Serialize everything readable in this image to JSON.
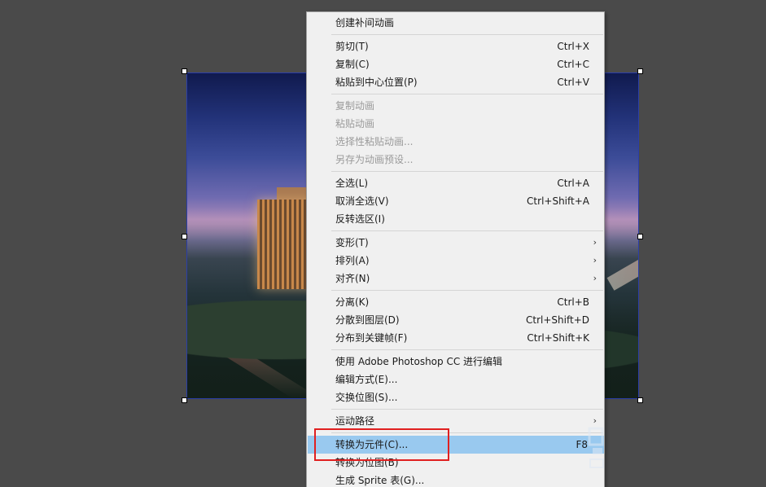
{
  "context_menu": {
    "items": [
      {
        "label": "创建补间动画",
        "shortcut": "",
        "disabled": false
      },
      {
        "label": "剪切(T)",
        "shortcut": "Ctrl+X",
        "disabled": false
      },
      {
        "label": "复制(C)",
        "shortcut": "Ctrl+C",
        "disabled": false
      },
      {
        "label": "粘贴到中心位置(P)",
        "shortcut": "Ctrl+V",
        "disabled": false
      },
      {
        "label": "复制动画",
        "shortcut": "",
        "disabled": true
      },
      {
        "label": "粘贴动画",
        "shortcut": "",
        "disabled": true
      },
      {
        "label": "选择性粘贴动画...",
        "shortcut": "",
        "disabled": true
      },
      {
        "label": "另存为动画预设...",
        "shortcut": "",
        "disabled": true
      },
      {
        "label": "全选(L)",
        "shortcut": "Ctrl+A",
        "disabled": false
      },
      {
        "label": "取消全选(V)",
        "shortcut": "Ctrl+Shift+A",
        "disabled": false
      },
      {
        "label": "反转选区(I)",
        "shortcut": "",
        "disabled": false
      },
      {
        "label": "变形(T)",
        "shortcut": "",
        "submenu": true
      },
      {
        "label": "排列(A)",
        "shortcut": "",
        "submenu": true
      },
      {
        "label": "对齐(N)",
        "shortcut": "",
        "submenu": true
      },
      {
        "label": "分离(K)",
        "shortcut": "Ctrl+B",
        "disabled": false
      },
      {
        "label": "分散到图层(D)",
        "shortcut": "Ctrl+Shift+D",
        "disabled": false
      },
      {
        "label": "分布到关键帧(F)",
        "shortcut": "Ctrl+Shift+K",
        "disabled": false
      },
      {
        "label": "使用 Adobe Photoshop CC 进行编辑",
        "shortcut": "",
        "disabled": false
      },
      {
        "label": "编辑方式(E)...",
        "shortcut": "",
        "disabled": false
      },
      {
        "label": "交换位图(S)...",
        "shortcut": "",
        "disabled": false
      },
      {
        "label": "运动路径",
        "shortcut": "",
        "submenu": true
      },
      {
        "label": "转换为元件(C)...",
        "shortcut": "F8",
        "highlighted": true
      },
      {
        "label": "转换为位图(B)",
        "shortcut": "",
        "disabled": false
      },
      {
        "label": "生成 Sprite 表(G)...",
        "shortcut": "",
        "disabled": false
      }
    ],
    "submenu_arrow": "›"
  },
  "colors": {
    "stage_background": "#4a4a4a",
    "menu_background": "#f0f0f0",
    "highlight": "#99c9ef",
    "annotation_red": "#e02020",
    "selection_border": "#2b3ea8"
  }
}
